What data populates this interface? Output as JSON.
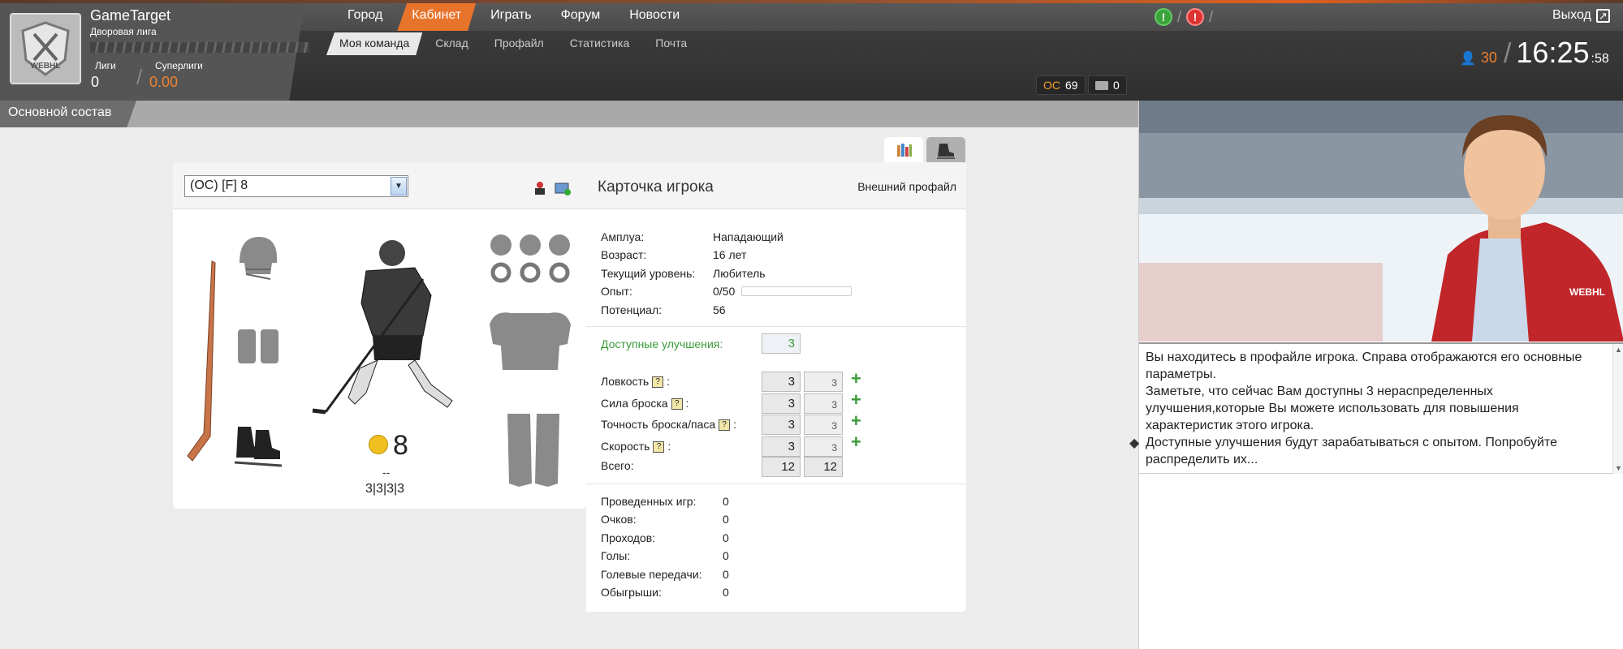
{
  "header": {
    "username": "GameTarget",
    "league_name": "Дворовая лига",
    "leagues_label": "Лиги",
    "leagues_value": "0",
    "superleagues_label": "Суперлиги",
    "superleagues_value": "0.00",
    "logo_text": "WEBHL"
  },
  "nav_main": [
    "Город",
    "Кабинет",
    "Играть",
    "Форум",
    "Новости"
  ],
  "nav_main_active": 1,
  "nav_sub": [
    "Моя команда",
    "Склад",
    "Профайл",
    "Статистика",
    "Почта"
  ],
  "nav_sub_active": 0,
  "alerts": {
    "green": "!",
    "red": "!"
  },
  "exit_label": "Выход",
  "status": {
    "online_count": "30",
    "time_hm": "16:25",
    "time_sec": ":58",
    "oc_label": "ОС",
    "oc_value": "69",
    "mail_count": "0"
  },
  "subbar_tab": "Основной состав",
  "player_select": "(ОС) [F] 8",
  "card": {
    "title": "Карточка игрока",
    "external_profile": "Внешний профайл",
    "info": [
      {
        "label": "Амплуа:",
        "value": "Нападающий"
      },
      {
        "label": "Возраст:",
        "value": "16 лет"
      },
      {
        "label": "Текущий уровень:",
        "value": "Любитель"
      },
      {
        "label": "Опыт:",
        "value": "0/50"
      },
      {
        "label": "Потенциал:",
        "value": "56"
      }
    ],
    "experience_progress": 0,
    "upgrades_label": "Доступные улучшения:",
    "upgrades_value": "3",
    "skills": [
      {
        "label": "Ловкость",
        "base": "3",
        "current": "3"
      },
      {
        "label": "Сила броска",
        "base": "3",
        "current": "3"
      },
      {
        "label": "Точность броска/паса",
        "base": "3",
        "current": "3"
      },
      {
        "label": "Скорость",
        "base": "3",
        "current": "3"
      }
    ],
    "skill_help_glyph": "?",
    "skill_colon": ":",
    "total_label": "Всего:",
    "total_base": "12",
    "total_current": "12",
    "stats": [
      {
        "label": "Проведенных игр:",
        "value": "0"
      },
      {
        "label": "Очков:",
        "value": "0"
      },
      {
        "label": "Проходов:",
        "value": "0"
      },
      {
        "label": "Голы:",
        "value": "0"
      },
      {
        "label": "Голевые передачи:",
        "value": "0"
      },
      {
        "label": "Обыгрыши:",
        "value": "0"
      }
    ]
  },
  "player": {
    "number": "8",
    "dashes": "--",
    "skill_summary": "3|3|3|3"
  },
  "coach": {
    "badge_text": "WEBHL",
    "message": [
      "Вы находитесь в профайле игрока. Справа отображаются его основные параметры.",
      "Заметьте, что сейчас Вам доступны 3 нераспределенных улучшения,которые Вы можете использовать для повышения характеристик этого игрока.",
      "Доступные улучшения будут зарабатываться с опытом. Попробуйте распределить их..."
    ]
  },
  "colors": {
    "accent": "#e8742c",
    "green": "#3a9a3a",
    "orange": "#f08030"
  }
}
